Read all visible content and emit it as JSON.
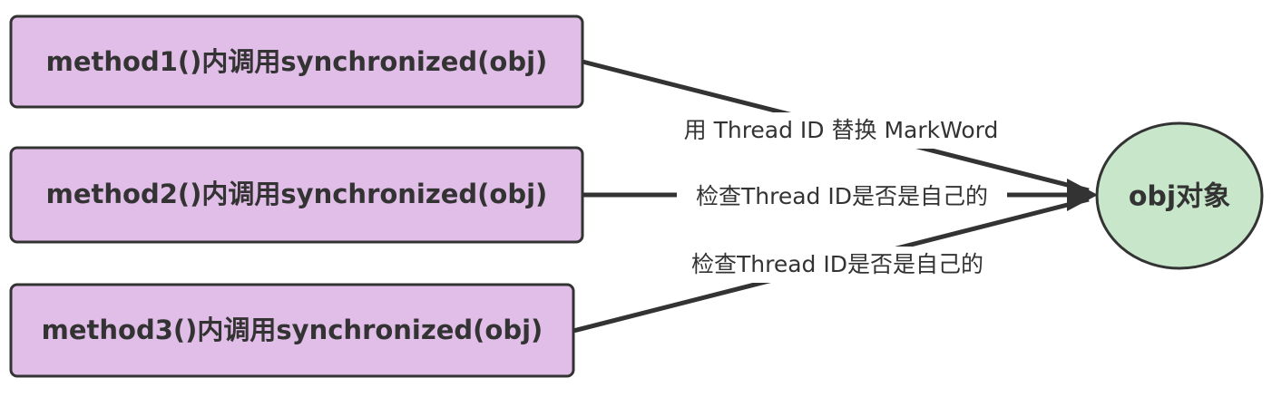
{
  "diagram": {
    "methods": [
      {
        "label": "method1()内调用synchronized(obj)"
      },
      {
        "label": "method2()内调用synchronized(obj)"
      },
      {
        "label": "method3()内调用synchronized(obj)"
      }
    ],
    "target": {
      "label": "obj对象"
    },
    "edges": [
      {
        "label": "用 Thread ID 替换 MarkWord"
      },
      {
        "label": "检查Thread ID是否是自己的"
      },
      {
        "label": "检查Thread ID是否是自己的"
      }
    ]
  },
  "colors": {
    "method_fill": "#e1bee7",
    "method_stroke": "#333333",
    "target_fill": "#c8e6c9",
    "target_stroke": "#333333",
    "line": "#333333",
    "text": "#333333"
  }
}
